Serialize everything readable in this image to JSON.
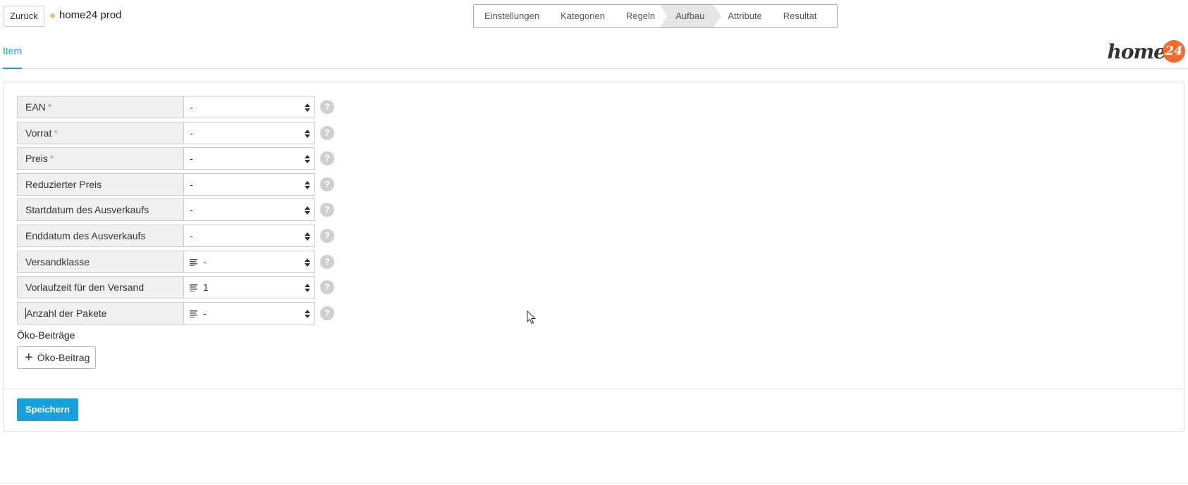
{
  "header": {
    "back_label": "Zurück",
    "title": "home24 prod",
    "status_color": "#f0c080"
  },
  "steps": [
    {
      "label": "Einstellungen",
      "active": false
    },
    {
      "label": "Kategorien",
      "active": false
    },
    {
      "label": "Regeln",
      "active": false
    },
    {
      "label": "Aufbau",
      "active": true
    },
    {
      "label": "Attribute",
      "active": false
    },
    {
      "label": "Resultat",
      "active": false
    }
  ],
  "tabs": {
    "active_label": "Item"
  },
  "brand": {
    "text": "home",
    "badge": "24",
    "badge_color": "#f26a30"
  },
  "form": {
    "rows": [
      {
        "label": "EAN",
        "required": "*",
        "value": "-",
        "icon": ""
      },
      {
        "label": "Vorrat",
        "required": "*",
        "value": "-",
        "icon": ""
      },
      {
        "label": "Preis",
        "required": "*",
        "value": "-",
        "icon": ""
      },
      {
        "label": "Reduzierter Preis",
        "required": "",
        "value": "-",
        "icon": ""
      },
      {
        "label": "Startdatum des Ausverkaufs",
        "required": "",
        "value": "-",
        "icon": ""
      },
      {
        "label": "Enddatum des Ausverkaufs",
        "required": "",
        "value": "-",
        "icon": ""
      },
      {
        "label": "Versandklasse",
        "required": "",
        "value": "-",
        "icon": "lines-icon"
      },
      {
        "label": "Vorlaufzeit für den Versand",
        "required": "",
        "value": "1",
        "icon": "lines-icon"
      },
      {
        "label": "Anzahl der Pakete",
        "required": "",
        "value": "-",
        "icon": "lines-icon"
      }
    ],
    "help_glyph": "?"
  },
  "eco": {
    "section_title": "Öko-Beiträge",
    "add_label": "Öko-Beitrag",
    "plus_glyph": "+"
  },
  "footer": {
    "save_label": "Speichern",
    "save_color": "#1a9fd9"
  }
}
